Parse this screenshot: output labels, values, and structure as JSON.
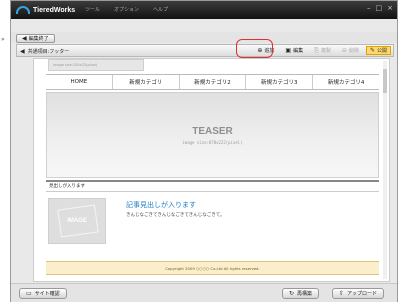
{
  "app": {
    "name": "TieredWorks"
  },
  "menu": [
    "ツール",
    "オプション",
    "ヘルプ"
  ],
  "window_controls": [
    "–",
    "□",
    "×"
  ],
  "toolbar1": {
    "end_edit_label": "編集終了"
  },
  "toolbar2": {
    "breadcrumb": "共通項目:フッター",
    "buttons": [
      {
        "label": "追加",
        "icon": "plus-icon",
        "state": "enabled"
      },
      {
        "label": "編集",
        "icon": "edit-icon",
        "state": "enabled"
      },
      {
        "label": "複製",
        "icon": "copy-icon",
        "state": "disabled"
      },
      {
        "label": "削除",
        "icon": "delete-icon",
        "state": "disabled"
      },
      {
        "label": "公開",
        "icon": "publish-icon",
        "state": "highlighted"
      }
    ]
  },
  "canvas": {
    "top_image_text": "image size:200x22(pixel)",
    "nav": [
      "HOME",
      "新規カテゴリ",
      "新規カテゴリ2",
      "新規カテゴリ3",
      "新規カテゴリ4"
    ],
    "teaser": {
      "title": "TEASER",
      "subtitle": "image size:870x222(pixel)"
    },
    "section_heading": "見出しが入ります",
    "image_placeholder": "IMAGE",
    "article": {
      "title": "記事見出しが入ります",
      "body": "きんじなごきてきんじなごきてきんじなごきて。"
    },
    "footer": "Copyright 2009 ○○○○ Co.Ltd All rights reserved."
  },
  "bottom": {
    "site_check_label": "サイト確認",
    "rebuild_label": "再構築",
    "upload_label": "アップロード"
  },
  "colors": {
    "highlight": "#e23030",
    "article_title": "#1e7fc4",
    "publish": "#ffd86b"
  }
}
